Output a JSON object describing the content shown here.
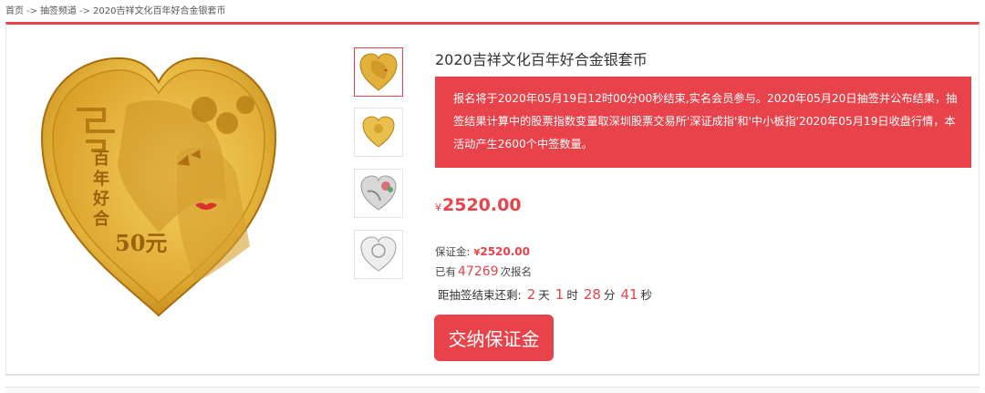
{
  "breadcrumb": {
    "home": "首页",
    "sep1": "->",
    "channel": "抽签频道",
    "sep2": "->",
    "current": "2020吉祥文化百年好合金银套币"
  },
  "product": {
    "title": "2020吉祥文化百年好合金银套币",
    "notice": "报名将于2020年05月19日12时00分00秒结束,实名会员参与。2020年05月20日抽签并公布结果，抽签结果计算中的股票指数变量取深圳股票交易所'深证成指'和'中小板指'2020年05月19日收盘行情，本活动产生2600个中签数量。",
    "currency_symbol": "¥",
    "price": "2520.00",
    "deposit_label": "保证金:",
    "deposit_currency": "¥",
    "deposit_amount": "2520.00",
    "count_prefix": "已有",
    "count_value": "47269",
    "count_suffix": "次报名",
    "countdown_label": "距抽签结束还剩:",
    "countdown": {
      "days": "2",
      "days_unit": "天",
      "hours": "1",
      "hours_unit": "时",
      "minutes": "28",
      "minutes_unit": "分",
      "seconds": "41",
      "seconds_unit": "秒"
    },
    "pay_button": "交纳保证金",
    "coin_text": {
      "line1": "百",
      "line2": "年",
      "line3": "好",
      "line4": "合",
      "value": "50元"
    }
  },
  "thumbnails": [
    {
      "name": "gold-coin-front",
      "active": true
    },
    {
      "name": "gold-coin-back",
      "active": false
    },
    {
      "name": "silver-coin-front",
      "active": false
    },
    {
      "name": "silver-coin-back",
      "active": false
    }
  ],
  "colors": {
    "accent": "#e8424a",
    "gold_light": "#f2d36a",
    "gold_dark": "#c98b16",
    "silver_light": "#f4f4f4",
    "silver_dark": "#a9a9a9"
  }
}
